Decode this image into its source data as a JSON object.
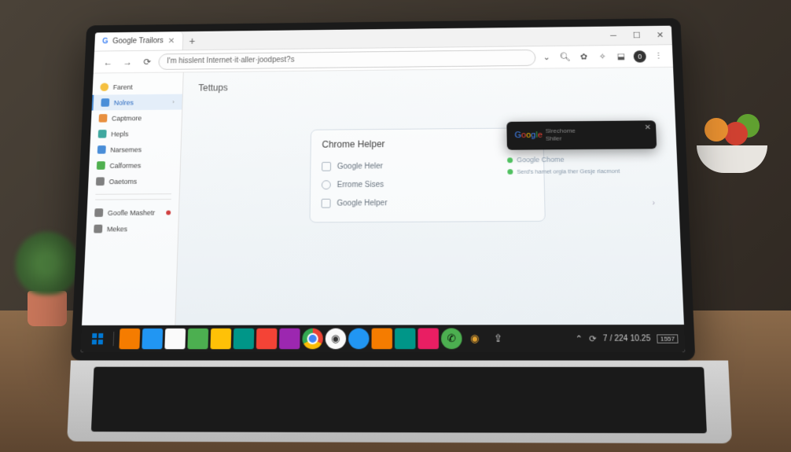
{
  "titlebar": {
    "tab_title": "Google Trailors",
    "tab_favicon": "G"
  },
  "toolbar": {
    "omnibox_text": "I'm hisslent Internet·it·aller·joodpest?s"
  },
  "sidebar": {
    "items": [
      {
        "icon": "si-yellow",
        "label": "Farent"
      },
      {
        "icon": "si-blue",
        "label": "Nolres",
        "active": true,
        "chevron": true
      },
      {
        "icon": "si-orange",
        "label": "Captmore"
      },
      {
        "icon": "si-teal",
        "label": "Hepls"
      },
      {
        "icon": "si-blue",
        "label": "Narsemes"
      },
      {
        "icon": "si-green",
        "label": "Calformes"
      },
      {
        "icon": "si-gray",
        "label": "Oaetoms"
      },
      {
        "icon": "si-gray",
        "label": "Goofle Mashetr",
        "dot": true
      },
      {
        "icon": "si-gray",
        "label": "Mekes"
      }
    ]
  },
  "main": {
    "page_title": "Tettups",
    "card_title": "Chrome Helper",
    "card_items": [
      {
        "shape": "square",
        "label": "Google Heler"
      },
      {
        "shape": "round",
        "label": "Errome Sises"
      },
      {
        "shape": "square",
        "label": "Google Helper"
      }
    ]
  },
  "notification": {
    "logo_text": "Google",
    "line1": "Slrechome",
    "line2": "Shiler",
    "below_title": "Google Chome",
    "below_sub": "Serd's hamet orgla ther Gesje rlacmont"
  },
  "taskbar": {
    "clock_text": "7 / 224 10.25",
    "battery_text": "1557"
  }
}
